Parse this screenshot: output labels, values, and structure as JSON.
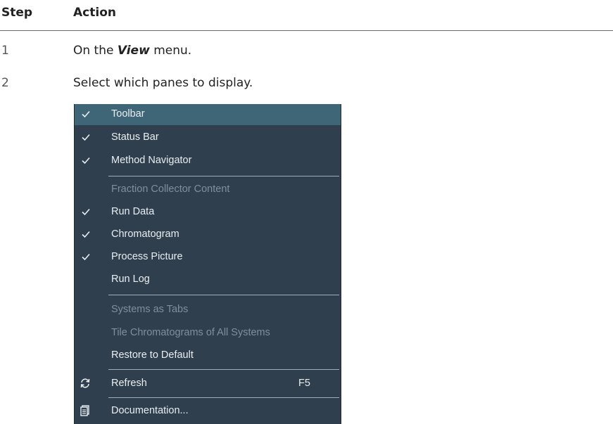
{
  "table": {
    "header": {
      "step": "Step",
      "action": "Action"
    },
    "rows": [
      {
        "num": "1",
        "text_before": "On the ",
        "text_bold": "View",
        "text_after": " menu."
      },
      {
        "num": "2",
        "text": "Select which panes to display."
      }
    ]
  },
  "menu": {
    "items": [
      {
        "label": "Toolbar",
        "checked": true,
        "highlighted": true,
        "disabled": false
      },
      {
        "label": "Status Bar",
        "checked": true,
        "disabled": false
      },
      {
        "label": "Method Navigator",
        "checked": true,
        "disabled": false
      },
      {
        "label": "Fraction Collector Content",
        "checked": false,
        "disabled": true
      },
      {
        "label": "Run Data",
        "checked": true,
        "disabled": false
      },
      {
        "label": "Chromatogram",
        "checked": true,
        "disabled": false
      },
      {
        "label": "Process Picture",
        "checked": true,
        "disabled": false
      },
      {
        "label": "Run Log",
        "checked": false,
        "disabled": false
      },
      {
        "label": "Systems as Tabs",
        "checked": false,
        "disabled": true
      },
      {
        "label": "Tile Chromatograms of All Systems",
        "checked": false,
        "disabled": true
      },
      {
        "label": "Restore to Default",
        "checked": false,
        "disabled": false
      },
      {
        "label": "Refresh",
        "shortcut": "F5",
        "icon": "refresh-icon",
        "disabled": false
      },
      {
        "label": "Documentation...",
        "icon": "document-icon",
        "disabled": false
      }
    ]
  },
  "colors": {
    "menu_bg": "#2f3f4d",
    "highlight": "#3f6676",
    "disabled_text": "#7f8f9c"
  }
}
